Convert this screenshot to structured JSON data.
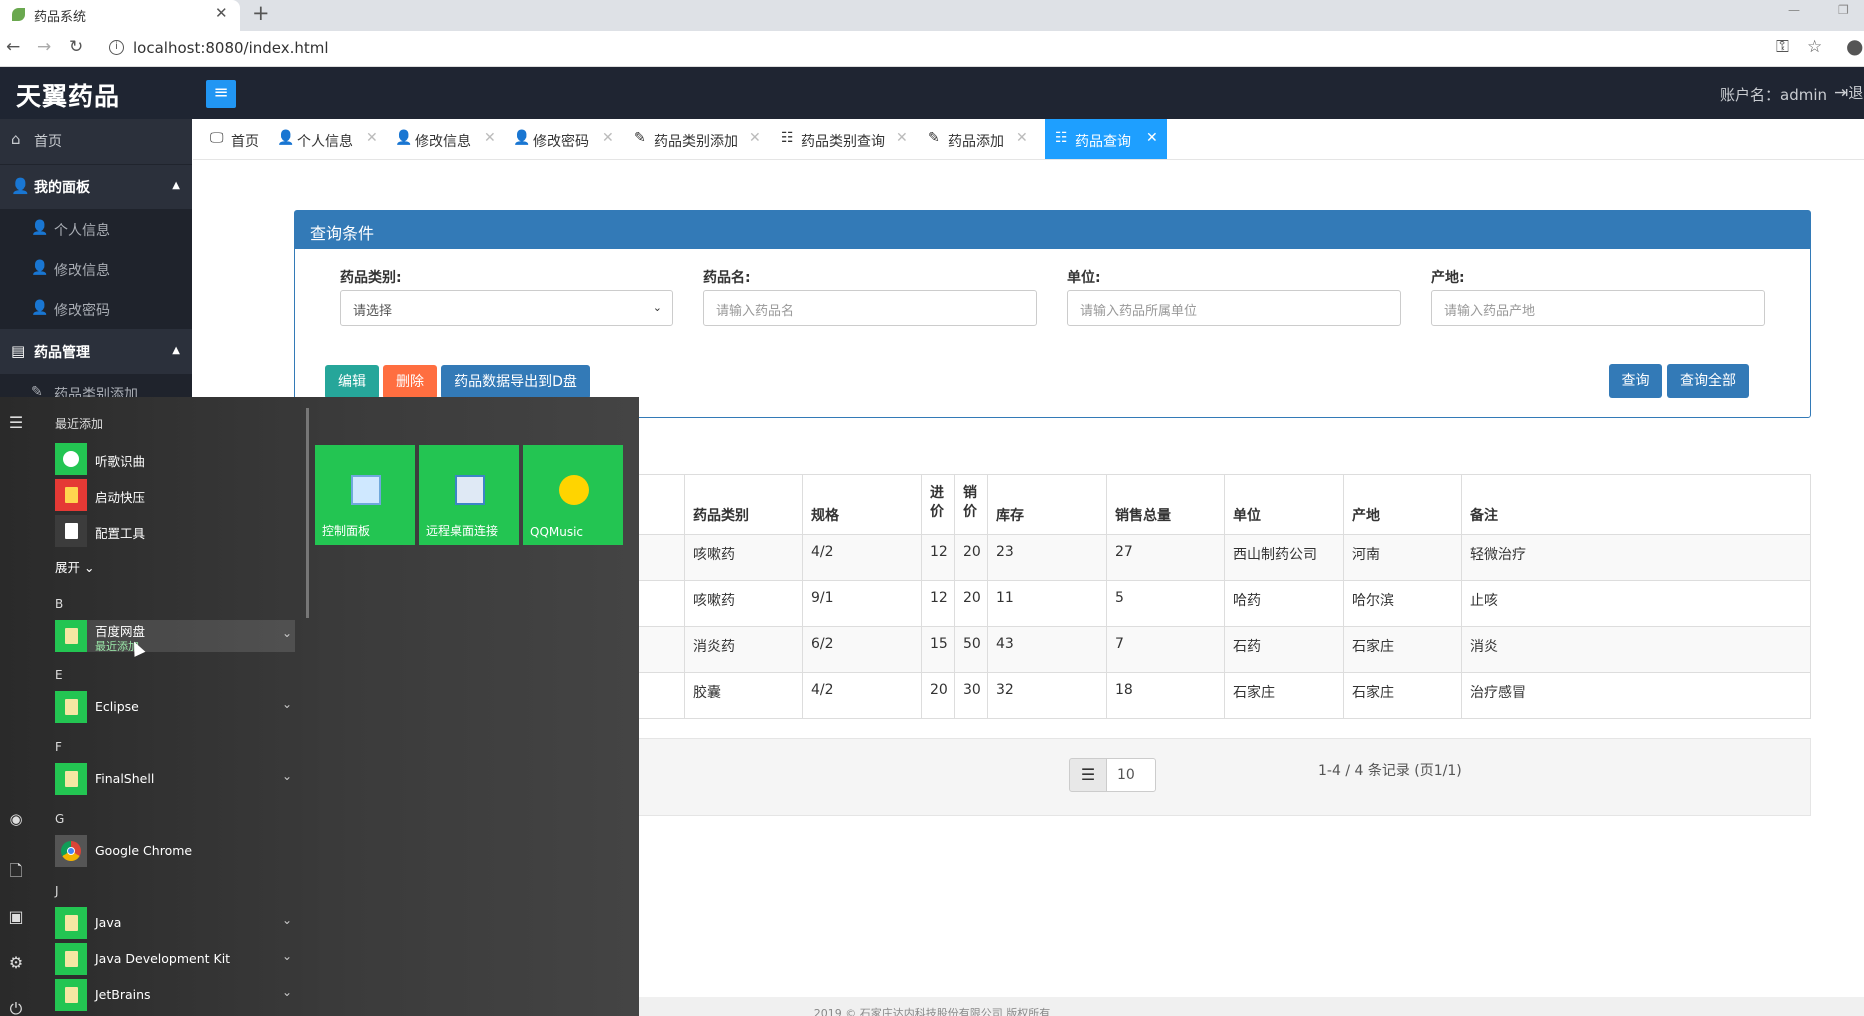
{
  "browser": {
    "tab_title": "药品系统",
    "url": "localhost:8080/index.html"
  },
  "app": {
    "logo": "天翼药品",
    "account_label": "账户名：admin",
    "logout_label": "退"
  },
  "sidebar": {
    "home": "首页",
    "my_panel": "我的面板",
    "personal_info": "个人信息",
    "edit_info": "修改信息",
    "change_password": "修改密码",
    "drug_mgmt": "药品管理",
    "drug_category_add": "药品类别添加"
  },
  "tabs": [
    {
      "label": "首页"
    },
    {
      "label": "个人信息"
    },
    {
      "label": "修改信息"
    },
    {
      "label": "修改密码"
    },
    {
      "label": "药品类别添加"
    },
    {
      "label": "药品类别查询"
    },
    {
      "label": "药品添加"
    },
    {
      "label": "药品查询"
    }
  ],
  "query": {
    "title": "查询条件",
    "category_label": "药品类别:",
    "category_value": "请选择",
    "name_label": "药品名:",
    "name_placeholder": "请输入药品名",
    "unit_label": "单位:",
    "unit_placeholder": "请输入药品所属单位",
    "origin_label": "产地:",
    "origin_placeholder": "请输入药品产地",
    "edit_btn": "编辑",
    "delete_btn": "删除",
    "export_btn": "药品数据导出到D盘",
    "search_btn": "查询",
    "search_all_btn": "查询全部"
  },
  "table": {
    "headers": {
      "category": "药品类别",
      "spec": "规格",
      "buy_price": "进价",
      "sell_price": "销价",
      "stock": "库存",
      "total_sales": "销售总量",
      "unit": "单位",
      "origin": "产地",
      "remark": "备注"
    },
    "rows": [
      {
        "category": "咳嗽药",
        "spec": "4/2",
        "buy": "12",
        "sell": "20",
        "stock": "23",
        "sales": "27",
        "unit": "西山制药公司",
        "origin": "河南",
        "remark": "轻微治疗"
      },
      {
        "category": "咳嗽药",
        "spec": "9/1",
        "buy": "12",
        "sell": "20",
        "stock": "11",
        "sales": "5",
        "unit": "哈药",
        "origin": "哈尔滨",
        "remark": "止咳"
      },
      {
        "category": "消炎药",
        "spec": "6/2",
        "buy": "15",
        "sell": "50",
        "stock": "43",
        "sales": "7",
        "unit": "石药",
        "origin": "石家庄",
        "remark": "消炎"
      },
      {
        "category": "胶囊",
        "spec": "4/2",
        "buy": "20",
        "sell": "30",
        "stock": "32",
        "sales": "18",
        "unit": "石家庄",
        "origin": "石家庄",
        "remark": "治疗感冒"
      }
    ]
  },
  "pager": {
    "page_size": "10",
    "summary": "1-4 / 4 条记录 (页1/1)"
  },
  "footer": "2019 © 石家庄达内科技股份有限公司 版权所有",
  "start_menu": {
    "recent_header": "最近添加",
    "recent": [
      "听歌识曲",
      "启动快压",
      "配置工具"
    ],
    "expand": "展开",
    "letters": [
      "B",
      "E",
      "F",
      "G",
      "J"
    ],
    "apps": {
      "baidu": "百度网盘",
      "baidu_sub": "最近添加",
      "eclipse": "Eclipse",
      "finalshell": "FinalShell",
      "chrome": "Google Chrome",
      "java": "Java",
      "jdk": "Java Development Kit",
      "jetbrains": "JetBrains"
    },
    "tiles": [
      "控制面板",
      "远程桌面连接",
      "QQMusic"
    ]
  }
}
